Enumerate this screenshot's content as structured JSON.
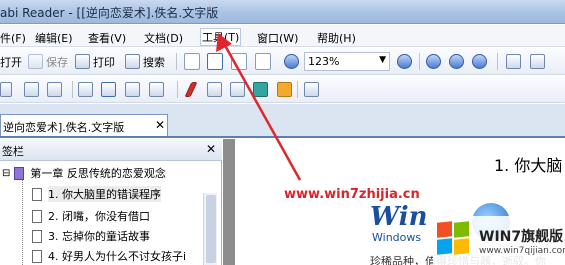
{
  "window": {
    "title": "abi Reader - [[逆向恋爱术].佚名.文字版"
  },
  "menubar": {
    "items": [
      {
        "label": "件(F)",
        "name": "menu-file"
      },
      {
        "label": "编辑(E)",
        "name": "menu-edit"
      },
      {
        "label": "查看(V)",
        "name": "menu-view"
      },
      {
        "label": "文档(D)",
        "name": "menu-document"
      },
      {
        "label": "工具(T)",
        "name": "menu-tools"
      },
      {
        "label": "窗口(W)",
        "name": "menu-window"
      },
      {
        "label": "帮助(H)",
        "name": "menu-help"
      }
    ]
  },
  "toolbar1": {
    "open_label": "打开",
    "save_label": "保存",
    "print_label": "打印",
    "search_label": "搜索",
    "zoom_value": "123%"
  },
  "tabs": {
    "doc_tab_label": "逆向恋爱术].佚名.文字版"
  },
  "sidebar": {
    "header_label": "签栏",
    "chapter_label": "第一章 反思传统的恋爱观念",
    "items": [
      "1. 你大脑里的错误程序",
      "2. 闭嘴，你没有借口",
      "3. 忘掉你的童话故事",
      "4. 好男人为什么不讨女孩子i"
    ]
  },
  "document": {
    "heading": "1. 你大脑",
    "body_text": "珍稀品种，值得珍惜与器，逝驭。你",
    "logo_main": "Win",
    "logo_sub": "Windows"
  },
  "overlay": {
    "watermark": "www.win7zhijia.cn",
    "badge_title": "WIN7旗舰版",
    "badge_url": "www.win7qijian.com"
  },
  "colors": {
    "arrow": "#e0262c",
    "watermark": "#d6252b",
    "titlebar": "#a9c2e4"
  }
}
